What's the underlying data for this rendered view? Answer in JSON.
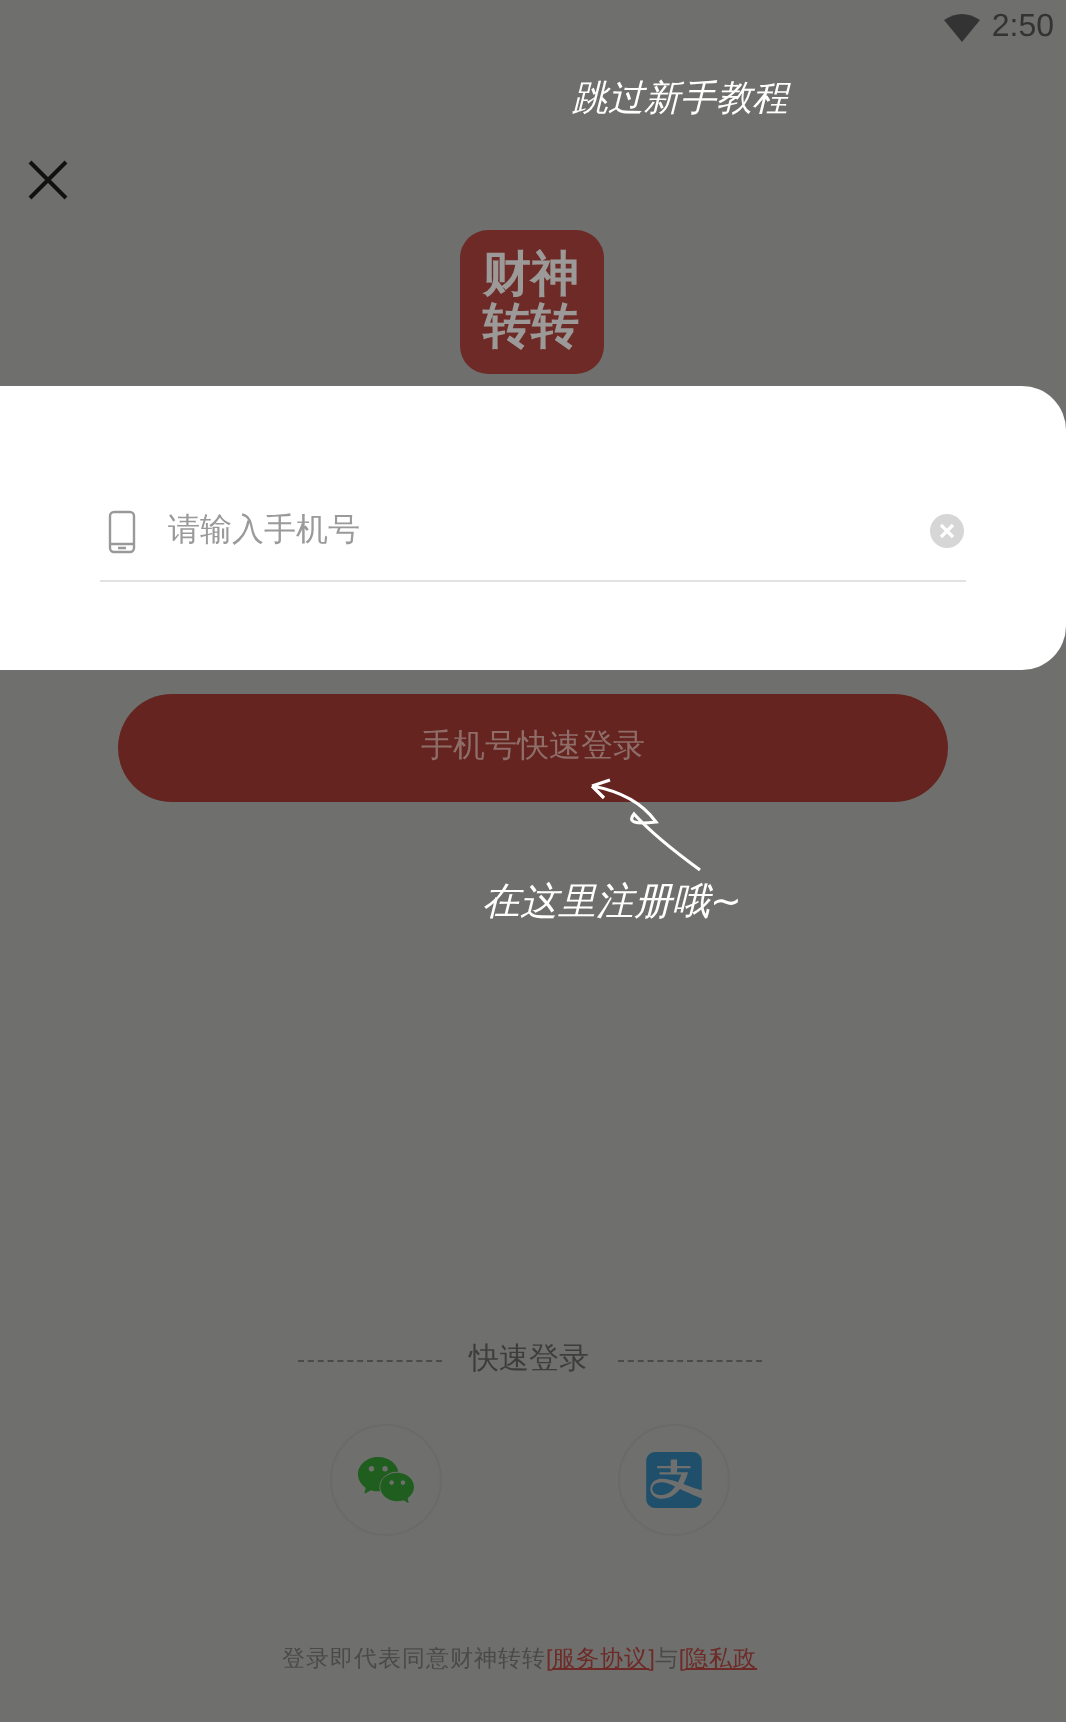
{
  "status_bar": {
    "time": "2:50"
  },
  "guide": {
    "skip": "跳过新手教程",
    "hint": "在这里注册哦~"
  },
  "logo": {
    "line_1": "财神",
    "line_2": "转转"
  },
  "phone_field": {
    "placeholder": "请输入手机号"
  },
  "login_button": {
    "label": "手机号快速登录"
  },
  "quick_login": {
    "title": "快速登录",
    "options": [
      {
        "kind": "wechat"
      },
      {
        "kind": "alipay"
      }
    ]
  },
  "footer": [
    {
      "kind": "text",
      "text": "登录即代表同意财神转转"
    },
    {
      "kind": "link",
      "text": "[服务协议]"
    },
    {
      "kind": "text",
      "text": "与"
    },
    {
      "kind": "link",
      "text": "[隐私政"
    }
  ]
}
